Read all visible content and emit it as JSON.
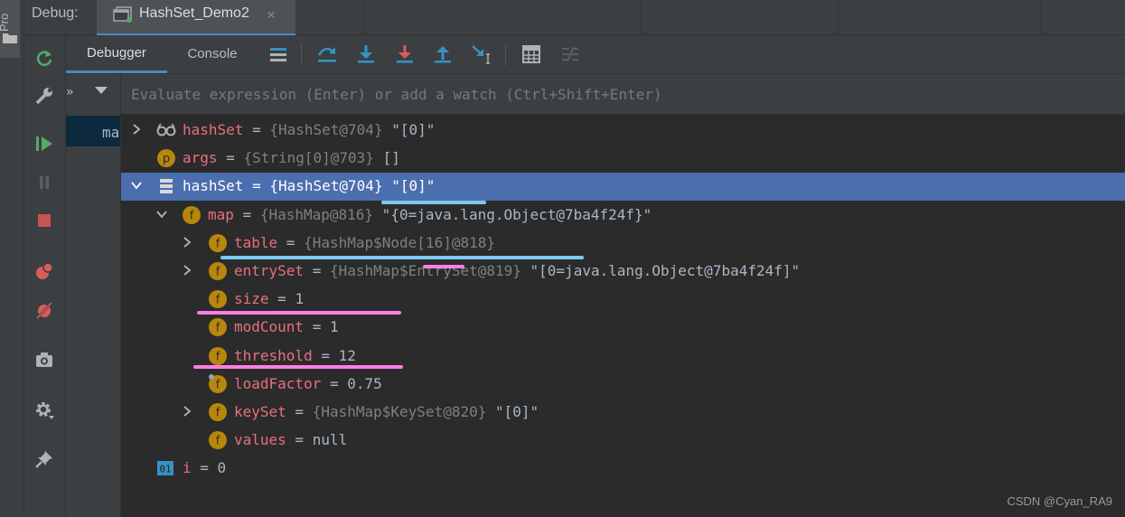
{
  "window": {
    "project_tab": "Pro",
    "debug_label": "Debug:",
    "session_tab": "HashSet_Demo2",
    "close_glyph": "×"
  },
  "tabs": [
    {
      "label": "Debugger",
      "active": true
    },
    {
      "label": "Console",
      "active": false
    }
  ],
  "toolbar_icons": [
    "layout-icon",
    "step-over-icon",
    "step-into-icon",
    "force-step-into-icon",
    "step-out-icon",
    "run-to-cursor-icon",
    "evaluate-icon",
    "trace-icon"
  ],
  "left_toolbar_icons": [
    "rerun-icon",
    "settings-wrench-icon",
    "resume-icon",
    "pause-icon",
    "stop-icon",
    "view-breakpoints-icon",
    "mute-breakpoints-icon",
    "camera-icon",
    "gear-icon",
    "pin-icon"
  ],
  "frames": {
    "chevron": "»",
    "selected_frame": "ma"
  },
  "watch": {
    "placeholder": "Evaluate expression (Enter) or add a watch (Ctrl+Shift+Enter)"
  },
  "variables": [
    {
      "name": "hashSet",
      "eq": " = ",
      "type": "{HashSet@704}",
      "value": " \"[0]\"",
      "icon": "watch",
      "expandable": true,
      "expanded": false,
      "depth": 0,
      "selected": false
    },
    {
      "name": "args",
      "eq": " = ",
      "type": "{String[0]@703}",
      "value": " []",
      "icon": "p",
      "expandable": false,
      "depth": 0,
      "selected": false
    },
    {
      "name": "hashSet",
      "eq": " = ",
      "type": "{HashSet@704}",
      "value": " \"[0]\"",
      "icon": "object",
      "expandable": true,
      "expanded": true,
      "depth": 0,
      "selected": true
    },
    {
      "name": "map",
      "eq": " = ",
      "type": "{HashMap@816}",
      "value": " \"{0=java.lang.Object@7ba4f24f}\"",
      "icon": "f",
      "expandable": true,
      "expanded": true,
      "depth": 1,
      "selected": false
    },
    {
      "name": "table",
      "eq": " = ",
      "type": "{HashMap$Node[16]@818}",
      "value": "",
      "icon": "f",
      "expandable": true,
      "expanded": false,
      "depth": 2,
      "selected": false
    },
    {
      "name": "entrySet",
      "eq": " = ",
      "type": "{HashMap$EntrySet@819}",
      "value": " \"[0=java.lang.Object@7ba4f24f]\"",
      "icon": "f",
      "expandable": true,
      "expanded": false,
      "depth": 2,
      "selected": false
    },
    {
      "name": "size",
      "eq": " = ",
      "type": "",
      "value": "1",
      "icon": "f",
      "expandable": false,
      "depth": 2,
      "selected": false
    },
    {
      "name": "modCount",
      "eq": " = ",
      "type": "",
      "value": "1",
      "icon": "f",
      "expandable": false,
      "depth": 2,
      "selected": false
    },
    {
      "name": "threshold",
      "eq": " = ",
      "type": "",
      "value": "12",
      "icon": "f",
      "expandable": false,
      "depth": 2,
      "selected": false
    },
    {
      "name": "loadFactor",
      "eq": " = ",
      "type": "",
      "value": "0.75",
      "icon": "f-final",
      "expandable": false,
      "depth": 2,
      "selected": false
    },
    {
      "name": "keySet",
      "eq": " = ",
      "type": "{HashMap$KeySet@820}",
      "value": " \"[0]\"",
      "icon": "f",
      "expandable": true,
      "expanded": false,
      "depth": 2,
      "selected": false
    },
    {
      "name": "values",
      "eq": " = ",
      "type": "",
      "value": "null",
      "icon": "f",
      "expandable": false,
      "depth": 2,
      "selected": false
    },
    {
      "name": "i",
      "eq": " = ",
      "type": "",
      "value": "0",
      "icon": "int",
      "expandable": false,
      "depth": 0,
      "selected": false
    }
  ],
  "icon_letters": {
    "p": "p",
    "f": "f",
    "int": "01"
  },
  "colors": {
    "selection": "#4b6eaf",
    "field_icon": "#b8860b",
    "var_name": "#e8707e",
    "highlight_blue": "#7ec8f2",
    "highlight_pink": "#ff7ee5"
  },
  "watermark": "CSDN @Cyan_RA9"
}
